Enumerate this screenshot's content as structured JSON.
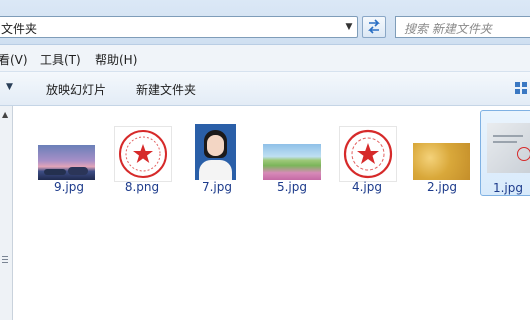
{
  "address": {
    "text": "文件夹"
  },
  "search": {
    "placeholder": "搜索 新建文件夹"
  },
  "menu": {
    "items": [
      "看(V)",
      "工具(T)",
      "帮助(H)"
    ]
  },
  "toolbar": {
    "slideshow_label": "放映幻灯片",
    "new_folder_label": "新建文件夹"
  },
  "files": [
    {
      "name": "9.jpg",
      "kind": "landscape-photo"
    },
    {
      "name": "8.png",
      "kind": "red-stamp"
    },
    {
      "name": "7.jpg",
      "kind": "portrait-photo"
    },
    {
      "name": "5.jpg",
      "kind": "flower-field-photo"
    },
    {
      "name": "4.jpg",
      "kind": "red-stamp"
    },
    {
      "name": "2.jpg",
      "kind": "gold-texture"
    },
    {
      "name": "1.jpg",
      "kind": "document-scan",
      "selected": true
    }
  ],
  "colors": {
    "file_label": "#1e3c8c",
    "selection": "#7fb1e3",
    "stamp_red": "#d62a2a"
  }
}
